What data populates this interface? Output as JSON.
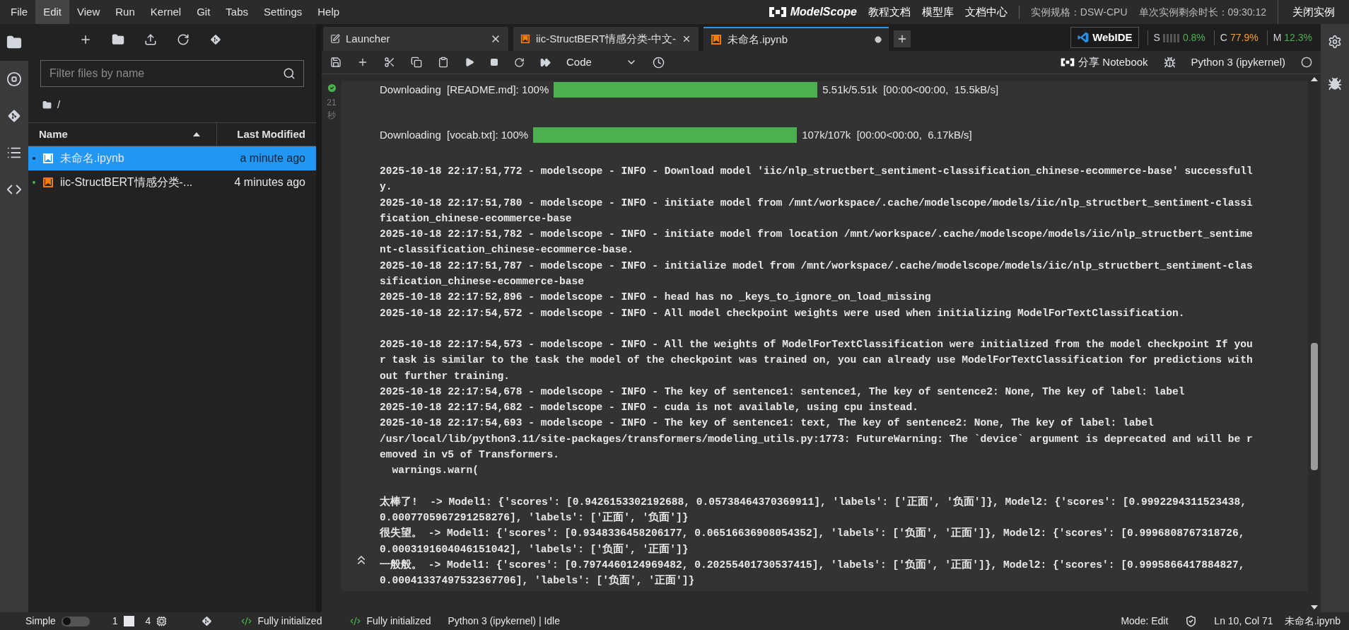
{
  "menu": [
    {
      "label": "File",
      "selected": false
    },
    {
      "label": "Edit",
      "selected": true
    },
    {
      "label": "View",
      "selected": false
    },
    {
      "label": "Run",
      "selected": false
    },
    {
      "label": "Kernel",
      "selected": false
    },
    {
      "label": "Git",
      "selected": false
    },
    {
      "label": "Tabs",
      "selected": false
    },
    {
      "label": "Settings",
      "selected": false
    },
    {
      "label": "Help",
      "selected": false
    }
  ],
  "brand": {
    "name": "ModelScope"
  },
  "top_links": [
    "教程文档",
    "模型库",
    "文档中心"
  ],
  "instance": {
    "spec": "实例规格：DSW-CPU",
    "remaining": "单次实例剩余时长：09:30:12",
    "close": "关闭实例"
  },
  "activity_bar": [
    {
      "kind": "files",
      "selected": true
    },
    {
      "kind": "running",
      "selected": false
    },
    {
      "kind": "git",
      "selected": false
    },
    {
      "kind": "toc",
      "selected": false
    },
    {
      "kind": "code",
      "selected": false
    }
  ],
  "file_browser": {
    "placeholder": "Filter files by name",
    "path": "/",
    "columns": [
      {
        "label": "Name",
        "sorted": true
      },
      {
        "label": "Last Modified",
        "sorted": false
      }
    ],
    "files": [
      {
        "name": "未命名.ipynb",
        "modified": "a minute ago",
        "selected": true,
        "running": true
      },
      {
        "name": "iic-StructBERT情感分类-...",
        "modified": "4 minutes ago",
        "selected": false,
        "running": true
      }
    ]
  },
  "tabs": [
    {
      "label": "Launcher",
      "kind": "launcher",
      "selected": false,
      "modified": false
    },
    {
      "label": "iic-StructBERT情感分类-中文-",
      "kind": "notebook",
      "selected": false,
      "modified": false
    },
    {
      "label": "未命名.ipynb",
      "kind": "notebook",
      "selected": true,
      "modified": true
    }
  ],
  "ide_badge": "WebIDE",
  "resources": [
    {
      "label": "S",
      "value": "0.8%",
      "color": "#4caf50",
      "kind": "graph"
    },
    {
      "label": "C",
      "value": "77.9%",
      "color": "#f0a030",
      "kind": "plain"
    },
    {
      "label": "M",
      "value": "12.3%",
      "color": "#4caf50",
      "kind": "plain"
    }
  ],
  "toolbar": {
    "cell_type": "Code",
    "share": "分享 Notebook",
    "kernel": "Python 3 (ipykernel)",
    "kernel_busy": false
  },
  "cell": {
    "kind": "success",
    "elapsed": "21",
    "elapsed_unit": "秒",
    "downloads": [
      {
        "label": "Downloading  [README.md]: 100%",
        "level": 1,
        "stats": "5.51k/5.51k  [00:00<00:00,  15.5kB/s]"
      },
      {
        "label": "Downloading  [vocab.txt]: 100%",
        "level": 1,
        "stats": "107k/107k  [00:00<00:00,  6.17kB/s]"
      }
    ],
    "log_blocks": [
      [
        "2025-10-18 22:17:51,772 - modelscope - INFO - Download model 'iic/nlp_structbert_sentiment-classification_chinese-ecommerce-base' successfull",
        "y.",
        "2025-10-18 22:17:51,780 - modelscope - INFO - initiate model from /mnt/workspace/.cache/modelscope/models/iic/nlp_structbert_sentiment-classi",
        "fication_chinese-ecommerce-base",
        "2025-10-18 22:17:51,782 - modelscope - INFO - initiate model from location /mnt/workspace/.cache/modelscope/models/iic/nlp_structbert_sentime",
        "nt-classification_chinese-ecommerce-base.",
        "2025-10-18 22:17:51,787 - modelscope - INFO - initialize model from /mnt/workspace/.cache/modelscope/models/iic/nlp_structbert_sentiment-clas",
        "sification_chinese-ecommerce-base",
        "2025-10-18 22:17:52,896 - modelscope - INFO - head has no _keys_to_ignore_on_load_missing",
        "2025-10-18 22:17:54,572 - modelscope - INFO - All model checkpoint weights were used when initializing ModelForTextClassification."
      ],
      [
        "2025-10-18 22:17:54,573 - modelscope - INFO - All the weights of ModelForTextClassification were initialized from the model checkpoint If you",
        "r task is similar to the task the model of the checkpoint was trained on, you can already use ModelForTextClassification for predictions with",
        "out further training.",
        "2025-10-18 22:17:54,678 - modelscope - INFO - The key of sentence1: sentence1, The key of sentence2: None, The key of label: label",
        "2025-10-18 22:17:54,682 - modelscope - INFO - cuda is not available, using cpu instead.",
        "2025-10-18 22:17:54,693 - modelscope - INFO - The key of sentence1: text, The key of sentence2: None, The key of label: label",
        "/usr/local/lib/python3.11/site-packages/transformers/modeling_utils.py:1773: FutureWarning: The `device` argument is deprecated and will be r",
        "emoved in v5 of Transformers.",
        "  warnings.warn("
      ],
      [
        "太棒了!  -> Model1: {'scores': [0.9426153302192688, 0.05738464370369911], 'labels': ['正面', '负面']}, Model2: {'scores': [0.9992294311523438,",
        "0.0007705967291258276], 'labels': ['正面', '负面']}",
        "很失望。 -> Model1: {'scores': [0.9348336458206177, 0.06516636908054352], 'labels': ['负面', '正面']}, Model2: {'scores': [0.9996808767318726,",
        "0.0003191604046151042], 'labels': ['负面', '正面']}",
        "一般般。 -> Model1: {'scores': [0.7974460124969482, 0.20255401730537415], 'labels': ['负面', '正面']}, Model2: {'scores': [0.9995866417884827,",
        "0.00041337497532367706], 'labels': ['负面', '正面']}"
      ]
    ]
  },
  "status_bar": {
    "simple_label": "Simple",
    "simple_mode": false,
    "terminals": "1",
    "kernels": "4",
    "extension_status": [
      "Fully initialized",
      "Fully initialized"
    ],
    "kernel_status": "Python 3 (ipykernel) | Idle",
    "mode": "Mode: Edit",
    "cursor": "Ln 10, Col 71",
    "file": "未命名.ipynb"
  }
}
